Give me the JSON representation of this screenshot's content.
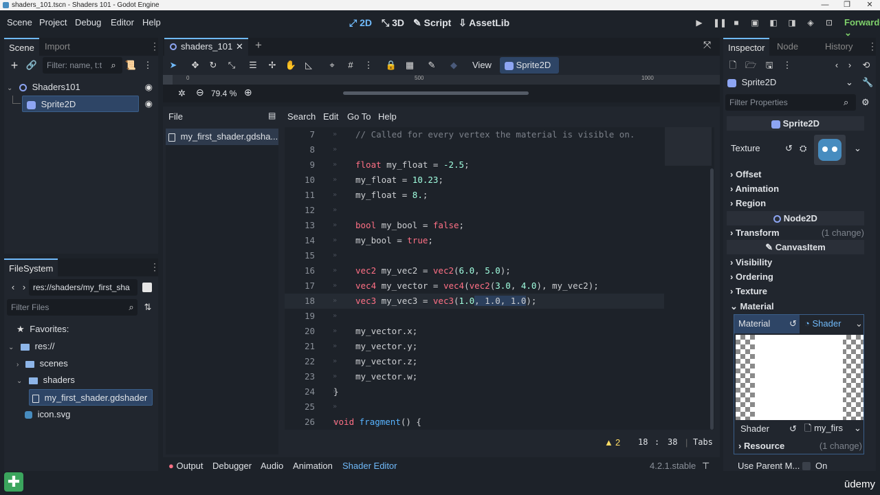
{
  "window": {
    "title": "shaders_101.tscn - Shaders 101 - Godot Engine"
  },
  "menu": [
    "Scene",
    "Project",
    "Debug",
    "Editor",
    "Help"
  ],
  "workspaces": [
    {
      "label": "2D",
      "icon": "2d-icon",
      "active": true
    },
    {
      "label": "3D",
      "icon": "3d-icon",
      "active": false
    },
    {
      "label": "Script",
      "icon": "script-icon",
      "active": false
    },
    {
      "label": "AssetLib",
      "icon": "assetlib-icon",
      "active": false
    }
  ],
  "renderer": "Forward+",
  "scene_dock": {
    "tabs": [
      "Scene",
      "Import"
    ],
    "filter_placeholder": "Filter: name, t:t",
    "nodes": [
      {
        "label": "Shaders101",
        "type": "node-icon"
      },
      {
        "label": "Sprite2D",
        "type": "sprite-icon",
        "selected": true
      }
    ]
  },
  "filesystem": {
    "tab": "FileSystem",
    "path": "res://shaders/my_first_sha",
    "filter_placeholder": "Filter Files",
    "favorites": "Favorites:",
    "items": [
      {
        "label": "res://",
        "kind": "folder",
        "indent": 0
      },
      {
        "label": "scenes",
        "kind": "folder",
        "indent": 1
      },
      {
        "label": "shaders",
        "kind": "folder",
        "indent": 1
      },
      {
        "label": "my_first_shader.gdshader",
        "kind": "file",
        "indent": 2,
        "selected": true
      },
      {
        "label": "icon.svg",
        "kind": "svg",
        "indent": 1
      }
    ]
  },
  "scene_tab": {
    "label": "shaders_101"
  },
  "viewport_toolbar": {
    "view_label": "View",
    "node_label": "Sprite2D",
    "zoom": "79.4 %"
  },
  "ruler_labels": [
    "0",
    "500",
    "1000"
  ],
  "shader_editor": {
    "menus": [
      "File",
      "Search",
      "Edit",
      "Go To",
      "Help"
    ],
    "file": "my_first_shader.gdsha...",
    "lines": [
      {
        "n": "7",
        "segs": [
          [
            "cm",
            "// Called for every vertex the material is visible on."
          ]
        ]
      },
      {
        "n": "8",
        "segs": []
      },
      {
        "n": "9",
        "segs": [
          [
            "kw",
            "float"
          ],
          [
            "tx",
            " my_float = "
          ],
          [
            "num",
            "-2.5"
          ],
          [
            "tx",
            ";"
          ]
        ]
      },
      {
        "n": "10",
        "segs": [
          [
            "tx",
            "my_float = "
          ],
          [
            "num",
            "10.23"
          ],
          [
            "tx",
            ";"
          ]
        ]
      },
      {
        "n": "11",
        "segs": [
          [
            "tx",
            "my_float = "
          ],
          [
            "num",
            "8."
          ],
          [
            "tx",
            ";"
          ]
        ]
      },
      {
        "n": "12",
        "segs": []
      },
      {
        "n": "13",
        "segs": [
          [
            "kw",
            "bool"
          ],
          [
            "tx",
            " my_bool = "
          ],
          [
            "kw",
            "false"
          ],
          [
            "tx",
            ";"
          ]
        ]
      },
      {
        "n": "14",
        "segs": [
          [
            "tx",
            "my_bool = "
          ],
          [
            "kw",
            "true"
          ],
          [
            "tx",
            ";"
          ]
        ]
      },
      {
        "n": "15",
        "segs": []
      },
      {
        "n": "16",
        "segs": [
          [
            "kw",
            "vec2"
          ],
          [
            "tx",
            " my_vec2 = "
          ],
          [
            "kw",
            "vec2"
          ],
          [
            "tx",
            "("
          ],
          [
            "num",
            "6.0"
          ],
          [
            "tx",
            ", "
          ],
          [
            "num",
            "5.0"
          ],
          [
            "tx",
            ");"
          ]
        ]
      },
      {
        "n": "17",
        "segs": [
          [
            "kw",
            "vec4"
          ],
          [
            "tx",
            " my_vector = "
          ],
          [
            "kw",
            "vec4"
          ],
          [
            "tx",
            "("
          ],
          [
            "kw",
            "vec2"
          ],
          [
            "tx",
            "("
          ],
          [
            "num",
            "3.0"
          ],
          [
            "tx",
            ", "
          ],
          [
            "num",
            "4.0"
          ],
          [
            "tx",
            "), my_vec2);"
          ]
        ]
      },
      {
        "n": "18",
        "segs": [
          [
            "kw",
            "vec3"
          ],
          [
            "tx",
            " my_vec3 = "
          ],
          [
            "kw",
            "vec3"
          ],
          [
            "tx",
            "("
          ],
          [
            "num",
            "1.0"
          ],
          [
            "hl",
            ", 1.0, 1.0"
          ],
          [
            "tx",
            ");"
          ]
        ],
        "current": true
      },
      {
        "n": "19",
        "segs": []
      },
      {
        "n": "20",
        "segs": [
          [
            "tx",
            "my_vector.x;"
          ]
        ]
      },
      {
        "n": "21",
        "segs": [
          [
            "tx",
            "my_vector.y;"
          ]
        ]
      },
      {
        "n": "22",
        "segs": [
          [
            "tx",
            "my_vector.z;"
          ]
        ]
      },
      {
        "n": "23",
        "segs": [
          [
            "tx",
            "my_vector.w;"
          ]
        ]
      },
      {
        "n": "24",
        "segs": [
          [
            "tx",
            "}"
          ]
        ]
      },
      {
        "n": "25",
        "segs": []
      },
      {
        "n": "26",
        "segs": [
          [
            "kw",
            "void"
          ],
          [
            "tx",
            " "
          ],
          [
            "fn",
            "fragment"
          ],
          [
            "tx",
            "() {"
          ]
        ]
      }
    ],
    "warnings": "2",
    "cursor_line": "18",
    "cursor_col": "38",
    "indent_mode": "Tabs"
  },
  "bottom_tabs": [
    "Output",
    "Debugger",
    "Audio",
    "Animation",
    "Shader Editor"
  ],
  "version": "4.2.1.stable",
  "inspector": {
    "tabs": [
      "Inspector",
      "Node",
      "History"
    ],
    "object": "Sprite2D",
    "filter_placeholder": "Filter Properties",
    "sprite_section": "Sprite2D",
    "texture_label": "Texture",
    "sprite_groups": [
      "Offset",
      "Animation",
      "Region"
    ],
    "node2d_section": "Node2D",
    "transform": "Transform",
    "change_note": "(1 change)",
    "canvas_section": "CanvasItem",
    "canvas_groups": [
      "Visibility",
      "Ordering",
      "Texture",
      "Material"
    ],
    "material_label": "Material",
    "material_value": "Shader",
    "shader_label": "Shader",
    "shader_value": "my_firs",
    "resource": "Resource",
    "use_parent_label": "Use Parent M...",
    "use_parent_value": "On"
  },
  "watermark": "ūdemy",
  "colors": {
    "accent": "#70bafa",
    "keyword": "#ff7085",
    "number": "#a1ffe0",
    "function": "#57b3ff",
    "warning": "#ffdd65"
  }
}
